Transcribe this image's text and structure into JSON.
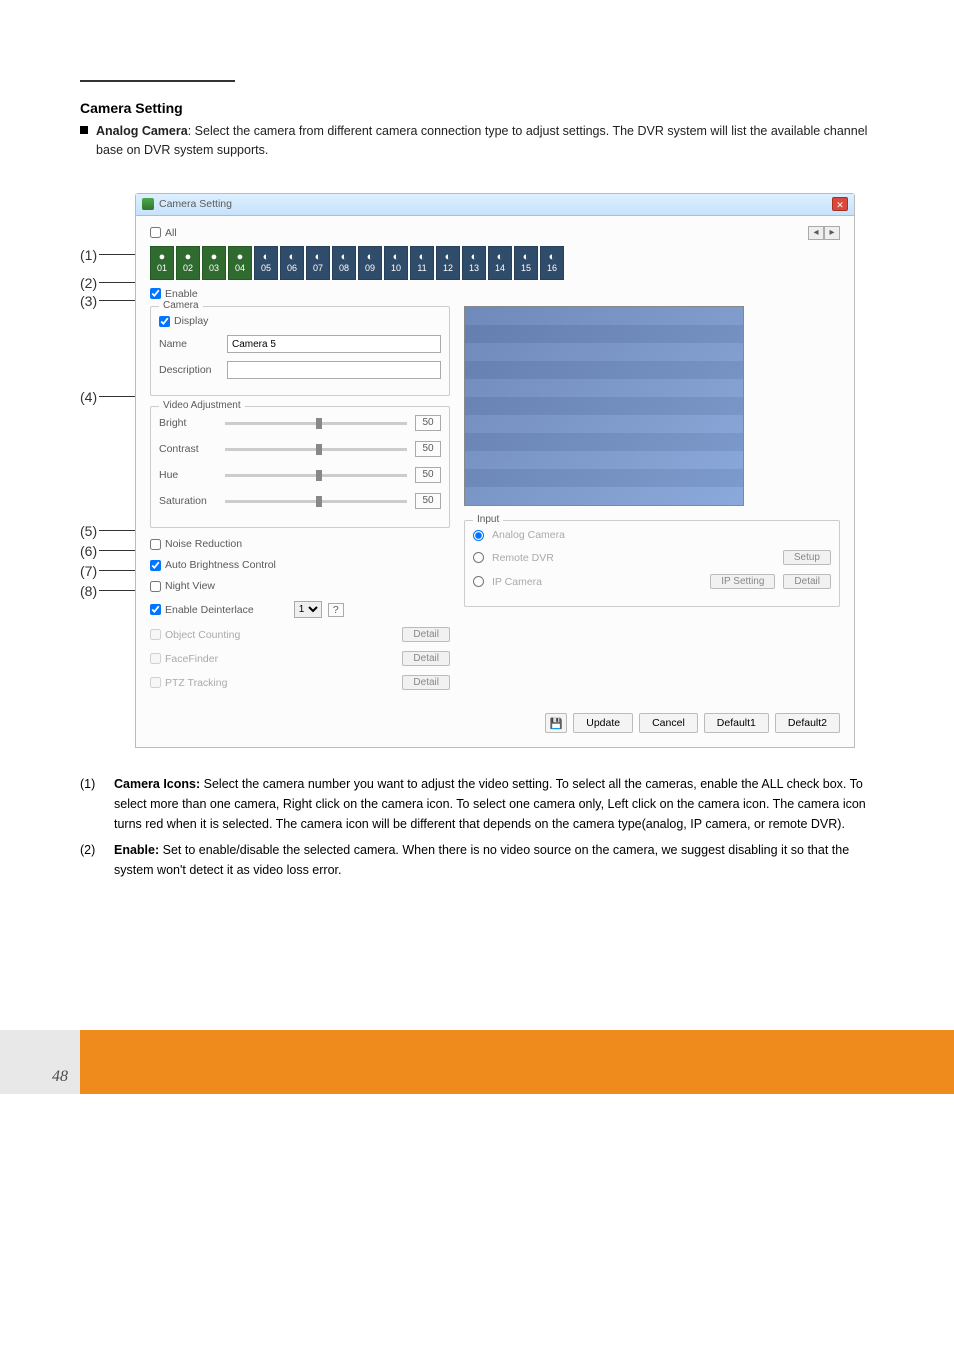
{
  "section": {
    "heading": "Camera Setting",
    "intro_bold": "Analog Camera",
    "intro_text": ": Select the camera from different camera connection type to adjust settings. The DVR system will list the available channel base on DVR system supports."
  },
  "shot": {
    "title": "Camera Setting",
    "all_label": "All",
    "enable_label": "Enable",
    "cameras": [
      "01",
      "02",
      "03",
      "04",
      "05",
      "06",
      "07",
      "08",
      "09",
      "10",
      "11",
      "12",
      "13",
      "14",
      "15",
      "16"
    ],
    "cam_group": {
      "title": "Camera",
      "display_label": "Display",
      "name_label": "Name",
      "name_value": "Camera 5",
      "desc_label": "Description"
    },
    "video_adj": {
      "title": "Video Adjustment",
      "rows": [
        {
          "label": "Bright",
          "value": "50"
        },
        {
          "label": "Contrast",
          "value": "50"
        },
        {
          "label": "Hue",
          "value": "50"
        },
        {
          "label": "Saturation",
          "value": "50"
        }
      ]
    },
    "opts": {
      "noise": "Noise Reduction",
      "auto_brightness": "Auto Brightness Control",
      "night_view": "Night View",
      "deinterlace": "Enable Deinterlace",
      "deinterlace_val": "1",
      "object_counting": "Object Counting",
      "facefinder": "FaceFinder",
      "ptz_tracking": "PTZ Tracking",
      "detail_btn": "Detail"
    },
    "input_group": {
      "title": "Input",
      "analog": "Analog Camera",
      "remote": "Remote DVR",
      "setup_btn": "Setup",
      "ip": "IP Camera",
      "ip_setting_btn": "IP Setting",
      "detail_btn": "Detail"
    },
    "buttons": {
      "update": "Update",
      "cancel": "Cancel",
      "default1": "Default1",
      "default2": "Default2"
    }
  },
  "callouts": [
    "(1)",
    "(2)",
    "(3)",
    "(4)",
    "(5)",
    "(6)",
    "(7)",
    "(8)"
  ],
  "list": {
    "items": [
      {
        "num": "(1)",
        "bold": "Camera Icons:",
        "text": " Select the camera number you want to adjust the video setting. To select all the cameras, enable the ALL check box. To select more than one camera, Right click on the camera icon. To select one camera only, Left click on the camera icon. The camera icon turns red when it is selected. The camera icon will be different that depends on the camera type(analog, IP camera, or remote DVR)."
      },
      {
        "num": "(2)",
        "bold": "Enable:",
        "text": " Set to enable/disable the selected camera. When there is no video source on the camera, we suggest disabling it so that the system won't detect it as video loss error."
      }
    ]
  },
  "footer_num": "48"
}
